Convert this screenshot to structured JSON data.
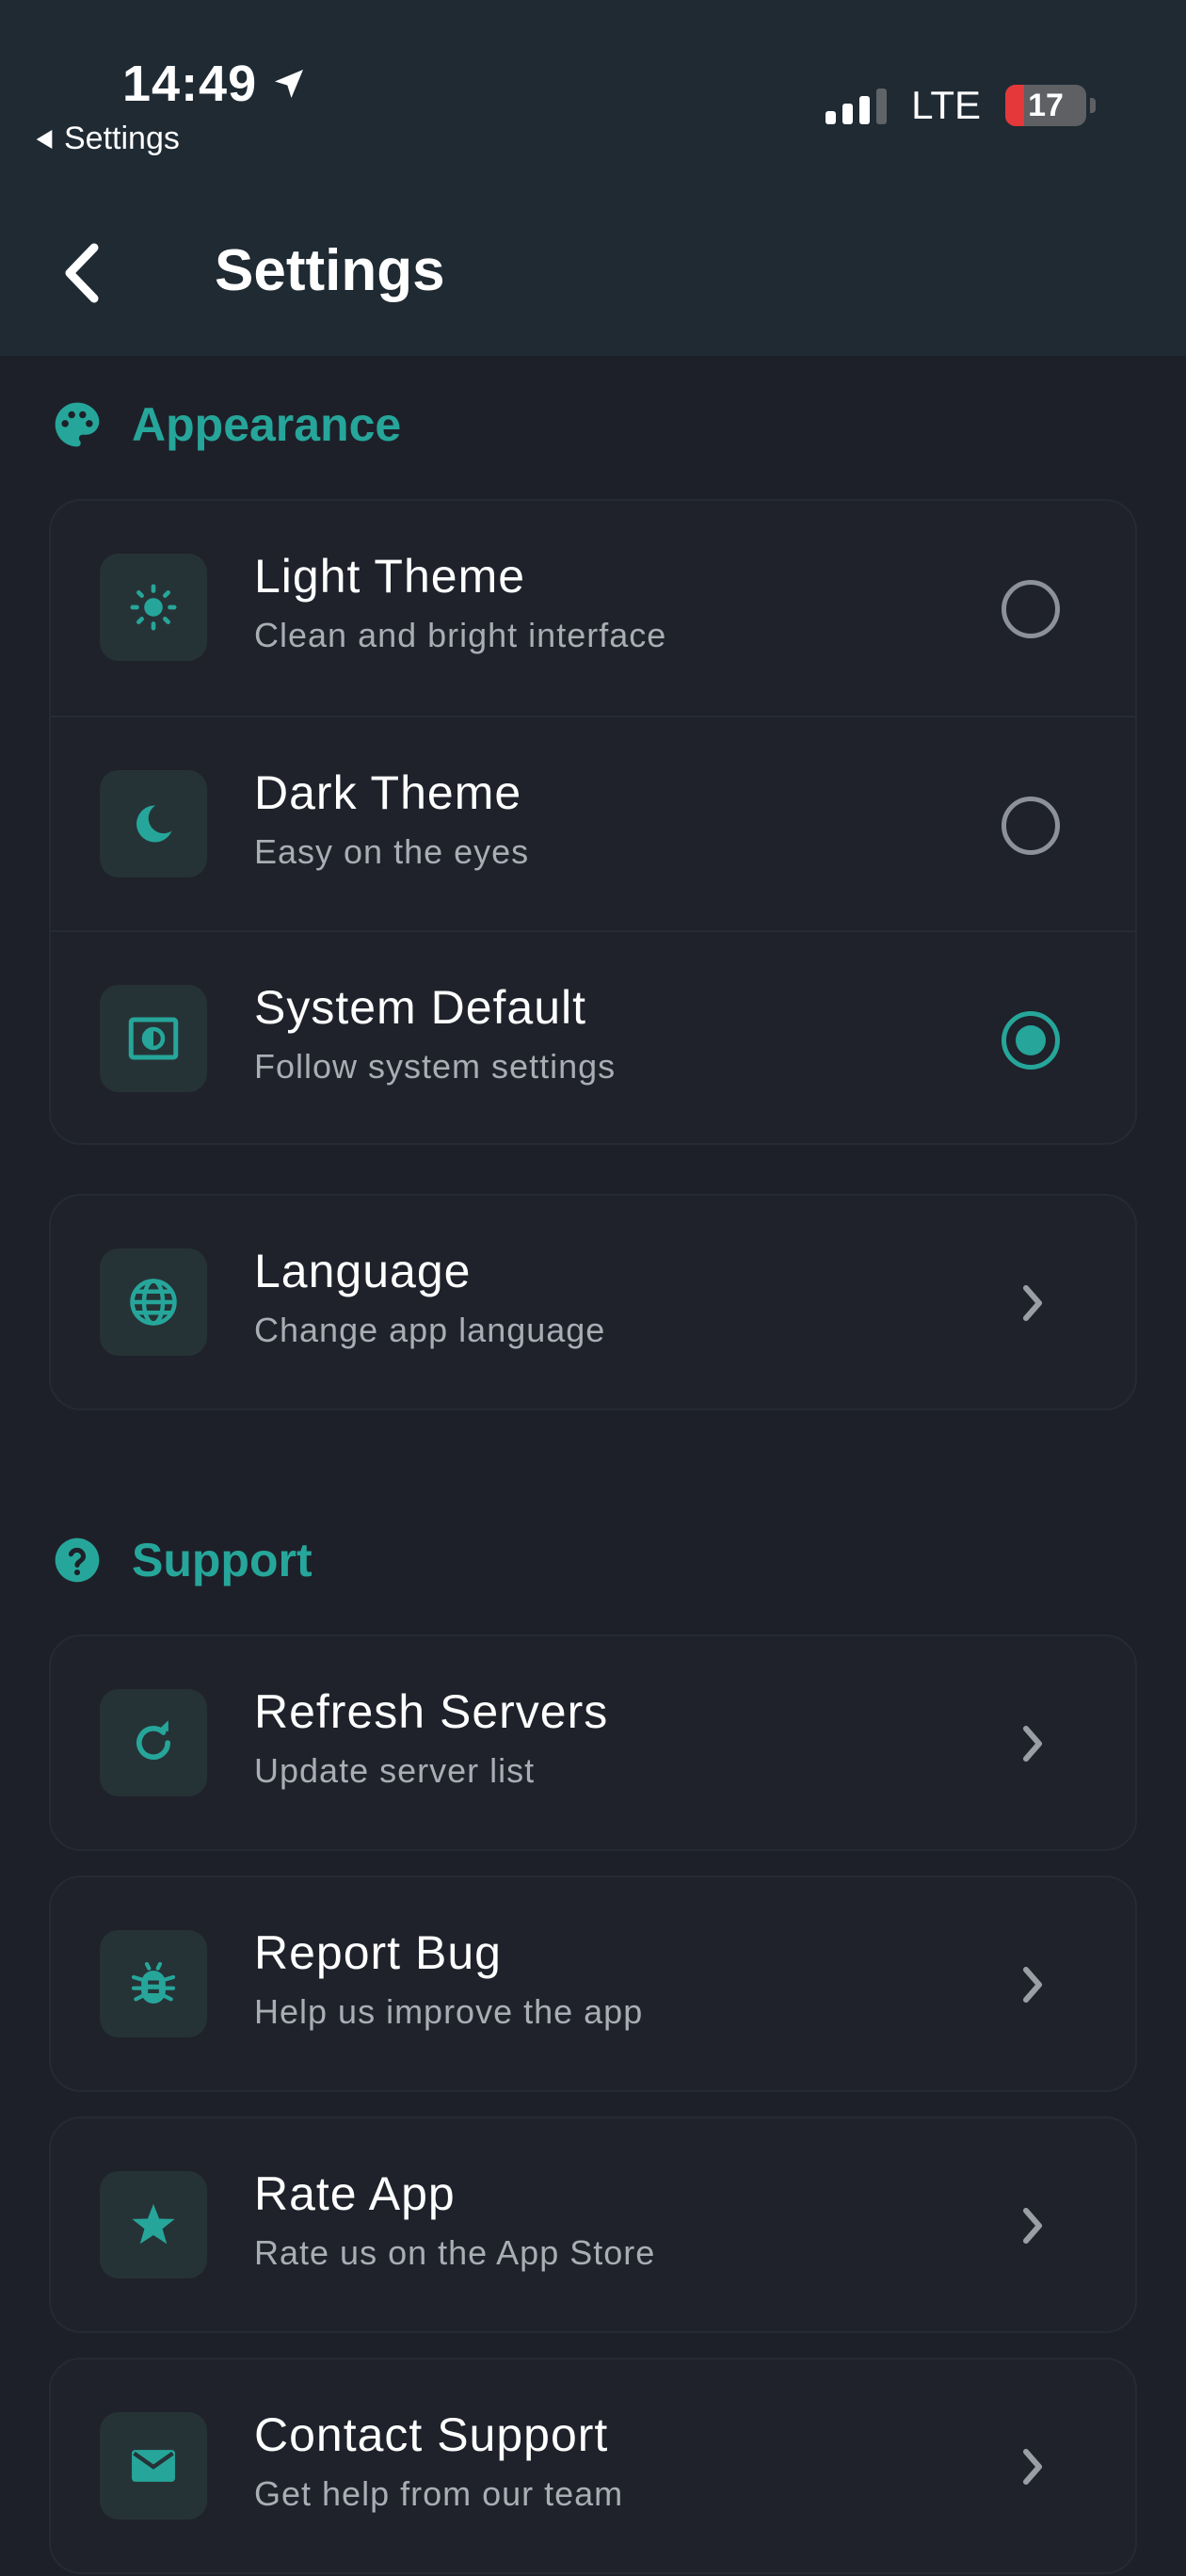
{
  "status_bar": {
    "time": "14:49",
    "back_app": "Settings",
    "network": "LTE",
    "battery": "17"
  },
  "header": {
    "title": "Settings"
  },
  "appearance": {
    "label": "Appearance",
    "themes": [
      {
        "title": "Light Theme",
        "subtitle": "Clean and bright interface",
        "icon": "sun-icon",
        "selected": false
      },
      {
        "title": "Dark Theme",
        "subtitle": "Easy on the eyes",
        "icon": "moon-icon",
        "selected": false
      },
      {
        "title": "System Default",
        "subtitle": "Follow system settings",
        "icon": "brightness-icon",
        "selected": true
      }
    ],
    "language": {
      "title": "Language",
      "subtitle": "Change app language",
      "icon": "globe-icon"
    }
  },
  "support": {
    "label": "Support",
    "items": [
      {
        "title": "Refresh Servers",
        "subtitle": "Update server list",
        "icon": "refresh-icon"
      },
      {
        "title": "Report Bug",
        "subtitle": "Help us improve the app",
        "icon": "bug-icon"
      },
      {
        "title": "Rate App",
        "subtitle": "Rate us on the App Store",
        "icon": "star-icon"
      },
      {
        "title": "Contact Support",
        "subtitle": "Get help from our team",
        "icon": "mail-icon"
      }
    ]
  },
  "colors": {
    "accent": "#26a69a",
    "background": "#1e2029",
    "header_bg": "#1f2a33",
    "card_bg": "#1f222b",
    "subtitle": "#a9adb4"
  }
}
